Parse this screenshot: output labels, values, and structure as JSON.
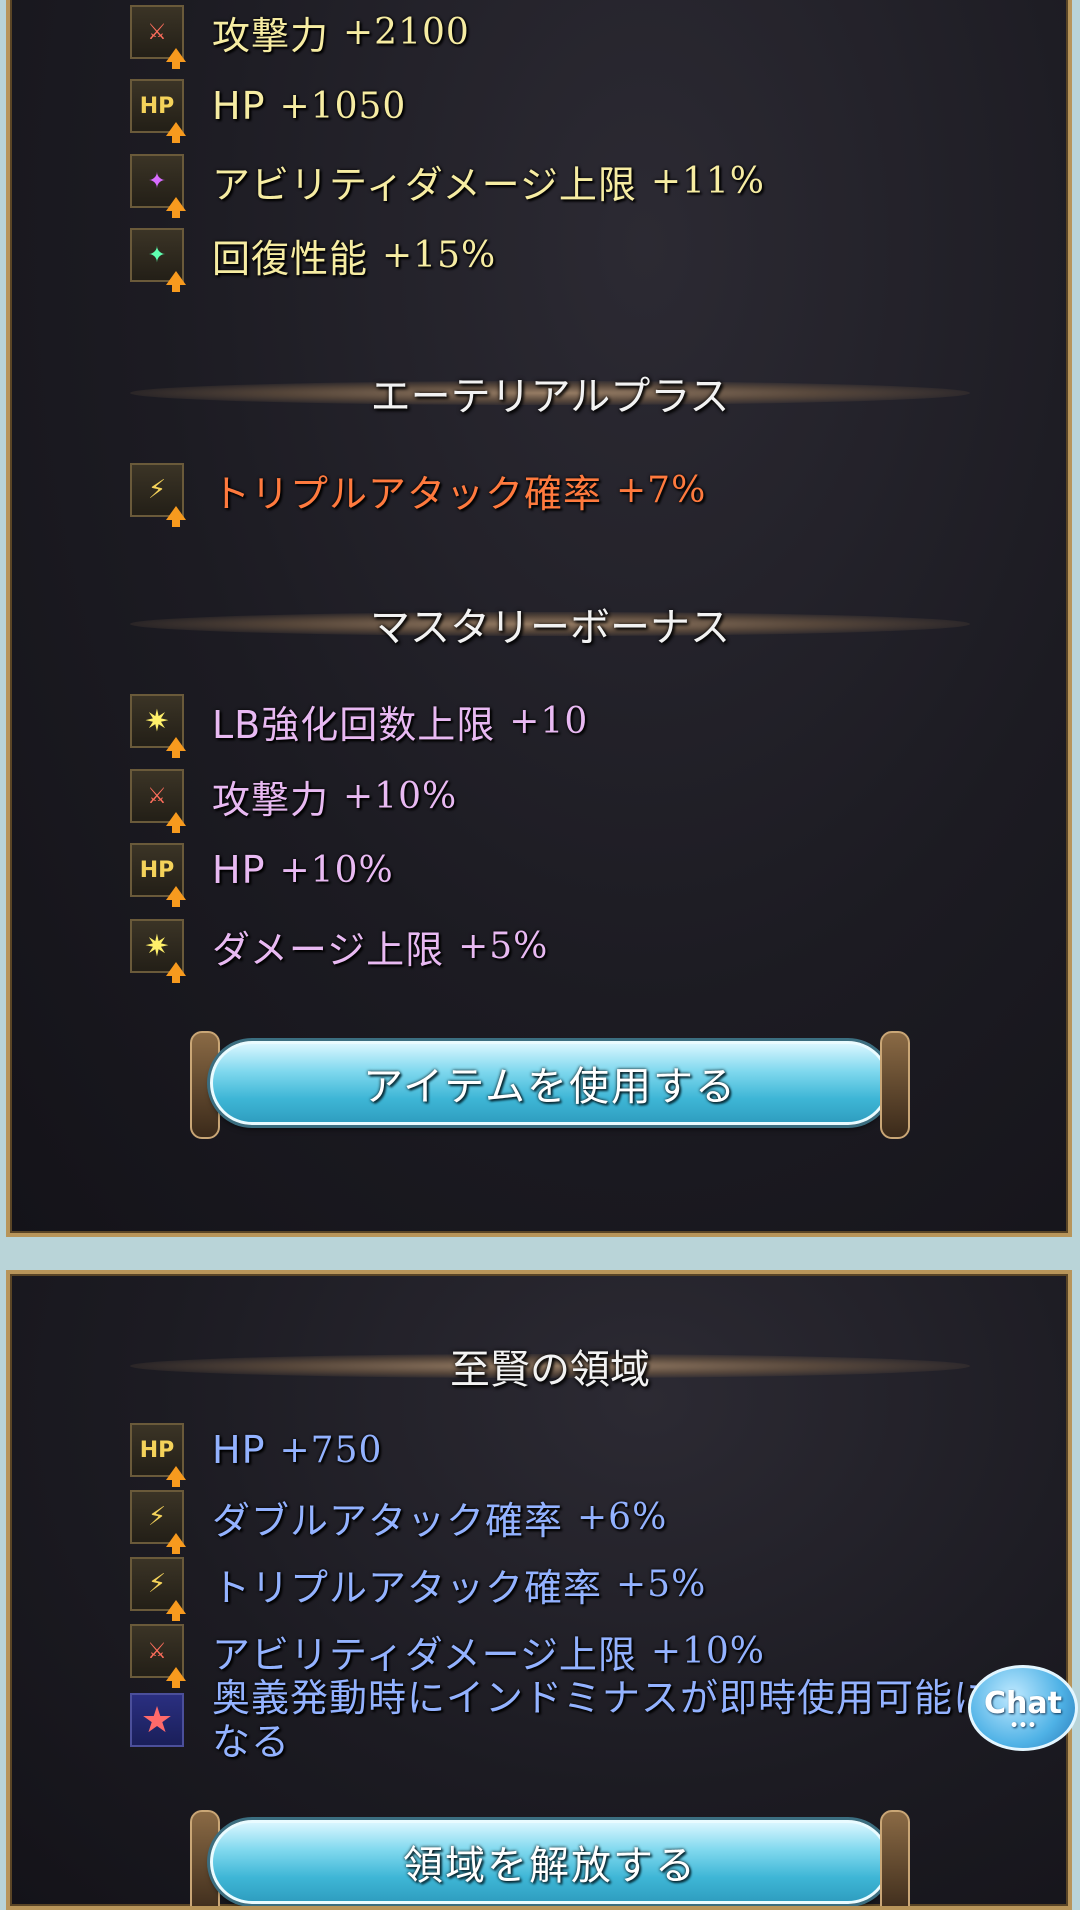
{
  "upper_panel": {
    "stats": [
      {
        "icon": "attack-sword-icon",
        "label": "攻撃力",
        "value": "+2100"
      },
      {
        "icon": "hp-icon",
        "label": "HP",
        "value": "+1050"
      },
      {
        "icon": "ability-damage-cap-icon",
        "label": "アビリティダメージ上限",
        "value": "+11%"
      },
      {
        "icon": "healing-icon",
        "label": "回復性能",
        "value": "+15%"
      }
    ],
    "ethereal": {
      "heading": "エーテリアルプラス",
      "items": [
        {
          "icon": "triple-attack-icon",
          "label": "トリプルアタック確率",
          "value": "+7%"
        }
      ]
    },
    "mastery": {
      "heading": "マスタリーボーナス",
      "items": [
        {
          "icon": "damage-cap-icon",
          "label": "LB強化回数上限",
          "value": "+10"
        },
        {
          "icon": "attack-sword-icon",
          "label": "攻撃力",
          "value": "+10%"
        },
        {
          "icon": "hp-icon",
          "label": "HP",
          "value": "+10%"
        },
        {
          "icon": "damage-cap-icon",
          "label": "ダメージ上限",
          "value": "+5%"
        }
      ]
    },
    "use_item_button": "アイテムを使用する",
    "icon_text": {
      "hp": "HP",
      "sword": "⚔",
      "spark": "✦",
      "star": "★"
    }
  },
  "lower_panel": {
    "heading": "至賢の領域",
    "items": [
      {
        "icon": "hp-icon",
        "label": "HP",
        "value": "+750"
      },
      {
        "icon": "double-attack-icon",
        "label": "ダブルアタック確率",
        "value": "+6%"
      },
      {
        "icon": "triple-attack-icon",
        "label": "トリプルアタック確率",
        "value": "+5%"
      },
      {
        "icon": "attack-sword-icon",
        "label": "アビリティダメージ上限",
        "value": "+10%"
      }
    ],
    "special": {
      "icon": "star-icon",
      "label": "奥義発動時にインドミナスが即時使用可能になる"
    },
    "release_button": "領域を解放する"
  },
  "chat": {
    "label": "Chat",
    "dots": "•••"
  },
  "colors": {
    "base_stat": "#f6eca2",
    "ethereal": "#ff7a3e",
    "mastery": "#e8b9f2",
    "domain": "#93b2ff",
    "button": "#3eb6d6"
  }
}
